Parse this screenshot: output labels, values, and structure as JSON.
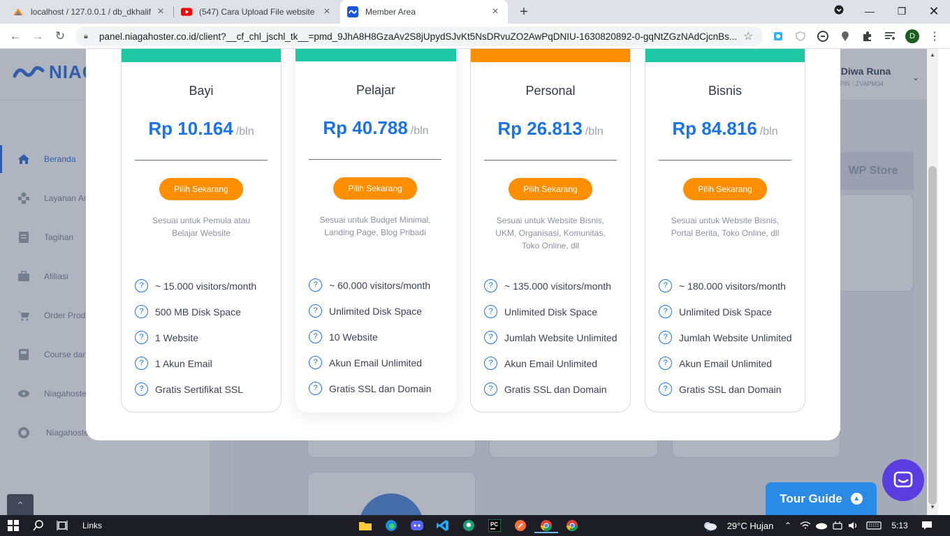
{
  "browser": {
    "tabs": [
      {
        "title": "localhost / 127.0.0.1 / db_dkhalif",
        "icon": "phpmyadmin-icon",
        "active": false
      },
      {
        "title": "(547) Cara Upload File website ke",
        "icon": "youtube-icon",
        "active": false
      },
      {
        "title": "Member Area",
        "icon": "niagahoster-icon",
        "active": true
      }
    ],
    "url": "panel.niagahoster.co.id/client?__cf_chl_jschl_tk__=pmd_9JhA8H8GzaAv2S8jUpydSJvKt5NsDRvuZO2AwPqDNIU-1630820892-0-gqNtZGzNAdCjcnBs...",
    "profile_initial": "D"
  },
  "app": {
    "logo_text": "NIAG",
    "greeting": ", Diwa Runa",
    "pin": "t PIN : ZVAPM34",
    "sidebar": [
      {
        "label": "Beranda",
        "icon": "home-icon",
        "active": true
      },
      {
        "label": "Layanan Ar",
        "icon": "services-icon",
        "active": false
      },
      {
        "label": "Tagihan",
        "icon": "invoice-icon",
        "active": false
      },
      {
        "label": "Afiliasi",
        "icon": "briefcase-icon",
        "active": false
      },
      {
        "label": "Order Produ",
        "icon": "cart-icon",
        "active": false
      },
      {
        "label": "Course dan",
        "icon": "book-icon",
        "active": false
      },
      {
        "label": "Niagahoste",
        "icon": "eye-icon",
        "active": false
      },
      {
        "label": "Niagahoste",
        "icon": "circle-icon",
        "active": false
      }
    ],
    "wp_store_label": "WP Store",
    "tour_guide_label": "Tour Guide"
  },
  "plans": [
    {
      "name": "Bayi",
      "price": "Rp 10.164",
      "period": "/bln",
      "button": "Pilih Sekarang",
      "accent": "#1ec8a5",
      "desc": [
        "Sesuai untuk Pemula atau",
        "Belajar Website"
      ],
      "features": [
        "~ 15.000 visitors/month",
        "500 MB Disk Space",
        "1 Website",
        "1 Akun Email",
        "Gratis Sertifikat SSL"
      ]
    },
    {
      "name": "Pelajar",
      "price": "Rp 40.788",
      "period": "/bln",
      "button": "Pilih Sekarang",
      "accent": "#1ec8a5",
      "desc": [
        "Sesuai untuk Budget Minimal,",
        "Landing Page, Blog Pribadi"
      ],
      "features": [
        "~ 60.000 visitors/month",
        "Unlimited Disk Space",
        "10 Website",
        "Akun Email Unlimited",
        "Gratis SSL dan Domain"
      ]
    },
    {
      "name": "Personal",
      "price": "Rp 26.813",
      "period": "/bln",
      "button": "Pilih Sekarang",
      "accent": "#ff8f00",
      "desc": [
        "Sesuai untuk Website Bisnis,",
        "UKM, Organisasi, Komunitas,",
        "Toko Online, dll"
      ],
      "features": [
        "~ 135.000 visitors/month",
        "Unlimited Disk Space",
        "Jumlah Website Unlimited",
        "Akun Email Unlimited",
        "Gratis SSL dan Domain"
      ]
    },
    {
      "name": "Bisnis",
      "price": "Rp 84.816",
      "period": "/bln",
      "button": "Pilih Sekarang",
      "accent": "#1ec8a5",
      "desc": [
        "Sesuai untuk Website Bisnis,",
        "Portal Berita, Toko Online, dll"
      ],
      "features": [
        "~ 180.000 visitors/month",
        "Unlimited Disk Space",
        "Jumlah Website Unlimited",
        "Akun Email Unlimited",
        "Gratis SSL dan Domain"
      ]
    }
  ],
  "taskbar": {
    "links_label": "Links",
    "weather": "29°C  Hujan",
    "time": "5:13",
    "apps": [
      "file-explorer-icon",
      "edge-icon",
      "discord-icon",
      "vscode-icon",
      "gitkraken-icon",
      "pycharm-icon",
      "postman-icon",
      "chrome-icon",
      "chrome-icon"
    ]
  }
}
